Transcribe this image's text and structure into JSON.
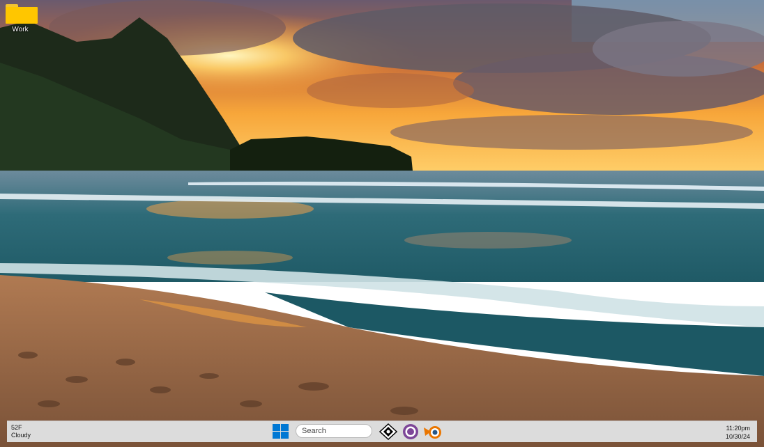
{
  "desktop": {
    "icons": [
      {
        "label": "Work",
        "icon": "folder-icon",
        "color": "#ffc600"
      }
    ]
  },
  "taskbar": {
    "weather": {
      "temperature": "52F",
      "condition": "Cloudy"
    },
    "search_placeholder": "Search",
    "apps": [
      {
        "icon": "windows-start-icon"
      },
      {
        "icon": "inkscape-icon"
      },
      {
        "icon": "tor-browser-icon"
      },
      {
        "icon": "blender-icon"
      }
    ],
    "clock": {
      "time": "11:20pm",
      "date": "10/30/24"
    }
  },
  "colors": {
    "taskbar_bg": "#dcdcdc",
    "start_blue": "#0078d4",
    "folder_yellow": "#ffc600"
  }
}
